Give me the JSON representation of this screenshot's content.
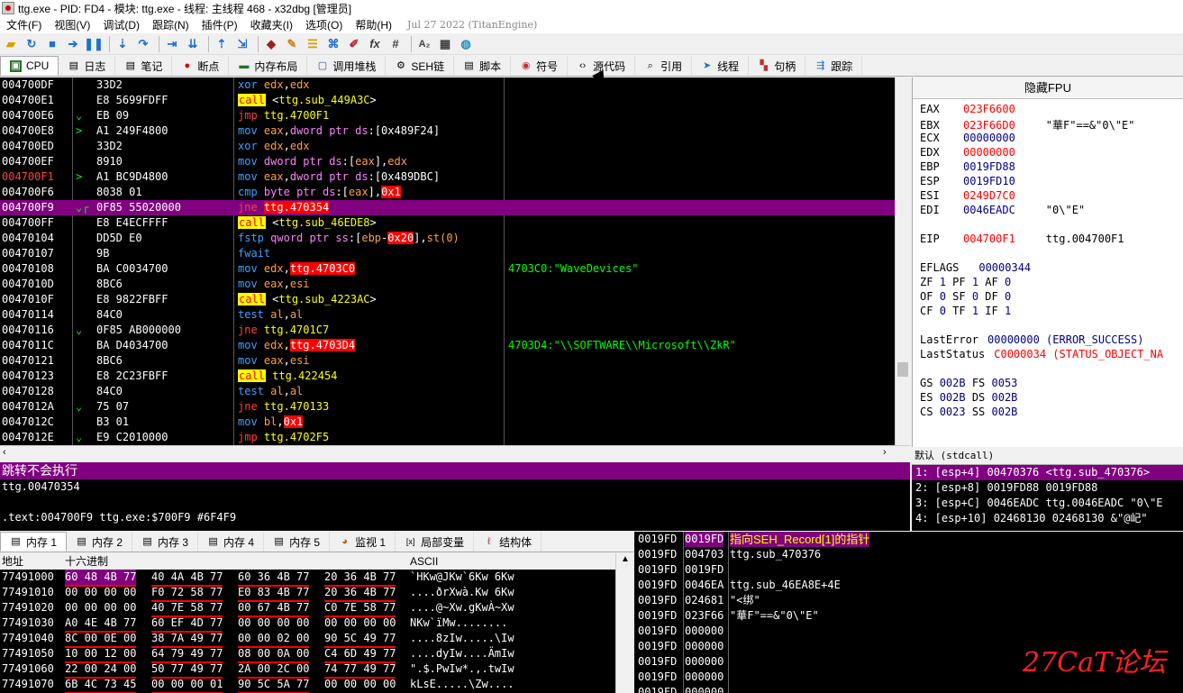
{
  "window": {
    "title": "ttg.exe - PID: FD4 - 模块: ttg.exe - 线程: 主线程 468 - x32dbg [管理员]"
  },
  "menu": {
    "items": [
      "文件(F)",
      "视图(V)",
      "调试(D)",
      "跟踪(N)",
      "插件(P)",
      "收藏夹(I)",
      "选项(O)",
      "帮助(H)"
    ],
    "date": "Jul 27 2022 (TitanEngine)"
  },
  "toolbar": {
    "fx_label": "fx",
    "hash_label": "#"
  },
  "tabs": [
    {
      "label": "CPU",
      "icon": "cpu-icon"
    },
    {
      "label": "日志",
      "icon": "log-icon"
    },
    {
      "label": "笔记",
      "icon": "notes-icon"
    },
    {
      "label": "断点",
      "icon": "breakpoint-icon"
    },
    {
      "label": "内存布局",
      "icon": "memory-map-icon"
    },
    {
      "label": "调用堆栈",
      "icon": "callstack-icon"
    },
    {
      "label": "SEH链",
      "icon": "seh-icon"
    },
    {
      "label": "脚本",
      "icon": "script-icon"
    },
    {
      "label": "符号",
      "icon": "symbols-icon"
    },
    {
      "label": "源代码",
      "icon": "source-icon"
    },
    {
      "label": "引用",
      "icon": "references-icon"
    },
    {
      "label": "线程",
      "icon": "threads-icon"
    },
    {
      "label": "句柄",
      "icon": "handles-icon"
    },
    {
      "label": "跟踪",
      "icon": "trace-icon"
    }
  ],
  "disasm": {
    "rows": [
      {
        "addr": "004700DF",
        "arrow": "",
        "bytes": "33D2",
        "ins": "xor edx,edx",
        "cmt": ""
      },
      {
        "addr": "004700E1",
        "arrow": "",
        "bytes": "E8 5699FDFF",
        "ins": "call <ttg.sub_449A3C>",
        "cmt": ""
      },
      {
        "addr": "004700E6",
        "arrow": "⌄",
        "bytes": "EB 09",
        "ins": "jmp ttg.4700F1",
        "cmt": ""
      },
      {
        "addr": "004700E8",
        "arrow": ">",
        "bytes": "A1 249F4800",
        "ins": "mov eax,dword ptr ds:[0x489F24]",
        "cmt": ""
      },
      {
        "addr": "004700ED",
        "arrow": "",
        "bytes": "33D2",
        "ins": "xor edx,edx",
        "cmt": ""
      },
      {
        "addr": "004700EF",
        "arrow": "",
        "bytes": "8910",
        "ins": "mov dword ptr ds:[eax],edx",
        "cmt": ""
      },
      {
        "addr": "004700F1",
        "arrow": ">",
        "bytes": "A1 BC9D4800",
        "ins": "mov eax,dword ptr ds:[0x489DBC]",
        "cmt": ""
      },
      {
        "addr": "004700F6",
        "arrow": "",
        "bytes": "8038 01",
        "ins": "cmp byte ptr ds:[eax],0x1",
        "cmt": ""
      },
      {
        "addr": "004700F9",
        "arrow": "⌄┌",
        "bytes": "0F85 55020000",
        "ins": "jne ttg.470354",
        "cmt": ""
      },
      {
        "addr": "004700FF",
        "arrow": "",
        "bytes": "E8 E4ECFFFF",
        "ins": "call <ttg.sub_46EDE8>",
        "cmt": ""
      },
      {
        "addr": "00470104",
        "arrow": "",
        "bytes": "DD5D E0",
        "ins": "fstp qword ptr ss:[ebp-0x20],st(0)",
        "cmt": ""
      },
      {
        "addr": "00470107",
        "arrow": "",
        "bytes": "9B",
        "ins": "fwait",
        "cmt": ""
      },
      {
        "addr": "00470108",
        "arrow": "",
        "bytes": "BA C0034700",
        "ins": "mov edx,ttg.4703C0",
        "cmt": "4703C0:\"WaveDevices\""
      },
      {
        "addr": "0047010D",
        "arrow": "",
        "bytes": "8BC6",
        "ins": "mov eax,esi",
        "cmt": ""
      },
      {
        "addr": "0047010F",
        "arrow": "",
        "bytes": "E8 9822FBFF",
        "ins": "call <ttg.sub_4223AC>",
        "cmt": ""
      },
      {
        "addr": "00470114",
        "arrow": "",
        "bytes": "84C0",
        "ins": "test al,al",
        "cmt": ""
      },
      {
        "addr": "00470116",
        "arrow": "⌄",
        "bytes": "0F85 AB000000",
        "ins": "jne ttg.4701C7",
        "cmt": ""
      },
      {
        "addr": "0047011C",
        "arrow": "",
        "bytes": "BA D4034700",
        "ins": "mov edx,ttg.4703D4",
        "cmt": "4703D4:\"\\\\SOFTWARE\\\\Microsoft\\\\ZkR\""
      },
      {
        "addr": "00470121",
        "arrow": "",
        "bytes": "8BC6",
        "ins": "mov eax,esi",
        "cmt": ""
      },
      {
        "addr": "00470123",
        "arrow": "",
        "bytes": "E8 2C23FBFF",
        "ins": "call ttg.422454",
        "cmt": ""
      },
      {
        "addr": "00470128",
        "arrow": "",
        "bytes": "84C0",
        "ins": "test al,al",
        "cmt": ""
      },
      {
        "addr": "0047012A",
        "arrow": "⌄",
        "bytes": "75 07",
        "ins": "jne ttg.470133",
        "cmt": ""
      },
      {
        "addr": "0047012C",
        "arrow": "",
        "bytes": "B3 01",
        "ins": "mov bl,0x1",
        "cmt": ""
      },
      {
        "addr": "0047012E",
        "arrow": "⌄",
        "bytes": "E9 C2010000",
        "ins": "jmp ttg.4702F5",
        "cmt": ""
      }
    ]
  },
  "registers": {
    "header": "隐藏FPU",
    "gpr": [
      {
        "name": "EAX",
        "value": "023F6600",
        "cmt": ""
      },
      {
        "name": "EBX",
        "value": "023F66D0",
        "cmt": "\"華F\"==&\"0\\\"E\""
      },
      {
        "name": "ECX",
        "value": "00000000",
        "cmt": ""
      },
      {
        "name": "EDX",
        "value": "00000000",
        "cmt": ""
      },
      {
        "name": "EBP",
        "value": "0019FD88",
        "cmt": ""
      },
      {
        "name": "ESP",
        "value": "0019FD10",
        "cmt": ""
      },
      {
        "name": "ESI",
        "value": "0249D7C0",
        "cmt": ""
      },
      {
        "name": "EDI",
        "value": "0046EADC",
        "cmt": "\"0\\\"E\""
      }
    ],
    "eip": {
      "name": "EIP",
      "value": "004700F1",
      "cmt": "ttg.004700F1"
    },
    "eflags": {
      "name": "EFLAGS",
      "value": "00000344"
    },
    "flags_rows": [
      "ZF 1  PF 1  AF 0",
      "OF 0  SF 0  DF 0",
      "CF 0  TF 1  IF 1"
    ],
    "last_error": {
      "name": "LastError",
      "value": "00000000 (ERROR_SUCCESS)"
    },
    "last_status": {
      "name": "LastStatus",
      "value": "C0000034 (STATUS_OBJECT_NA"
    },
    "seg_rows": [
      "GS 002B  FS 0053",
      "ES 002B  DS 002B",
      "CS 0023  SS 002B"
    ]
  },
  "info": {
    "header": "跳转不会执行",
    "line1": "ttg.00470354",
    "line2": "",
    "line3": ".text:004700F9 ttg.exe:$700F9 #6F4F9"
  },
  "args": {
    "conv": "默认 (stdcall)",
    "rows": [
      "1: [esp+4] 00470376 <ttg.sub_470376>",
      "2: [esp+8] 0019FD88 0019FD88",
      "3: [esp+C] 0046EADC ttg.0046EADC \"0\\\"E",
      "4: [esp+10] 02468130 02468130 &\"@屺\""
    ]
  },
  "dumptabs": [
    {
      "label": "内存 1",
      "icon": "dump-icon"
    },
    {
      "label": "内存 2",
      "icon": "dump-icon"
    },
    {
      "label": "内存 3",
      "icon": "dump-icon"
    },
    {
      "label": "内存 4",
      "icon": "dump-icon"
    },
    {
      "label": "内存 5",
      "icon": "dump-icon"
    },
    {
      "label": "监视 1",
      "icon": "watch-icon"
    },
    {
      "label": "局部变量",
      "icon": "locals-icon"
    },
    {
      "label": "结构体",
      "icon": "struct-icon"
    }
  ],
  "dump": {
    "col_addr": "地址",
    "col_hex": "十六进制",
    "col_ascii": "ASCII",
    "rows": [
      {
        "addr": "77491000",
        "g": [
          "60 48 4B 77",
          "40 4A 4B 77",
          "60 36 4B 77",
          "20 36 4B 77"
        ],
        "ascii": "`HKw@JKw`6Kw 6Kw"
      },
      {
        "addr": "77491010",
        "g": [
          "00 00 00 00",
          "F0 72 58 77",
          "E0 83 4B 77",
          "20 36 4B 77"
        ],
        "ascii": "....ðrXwà.Kw 6Kw"
      },
      {
        "addr": "77491020",
        "g": [
          "00 00 00 00",
          "40 7E 58 77",
          "00 67 4B 77",
          "C0 7E 58 77"
        ],
        "ascii": "....@~Xw.gKwÀ~Xw"
      },
      {
        "addr": "77491030",
        "g": [
          "A0 4E 4B 77",
          "60 EF 4D 77",
          "00 00 00 00",
          "00 00 00 00"
        ],
        "ascii": " NKw`ïMw........"
      },
      {
        "addr": "77491040",
        "g": [
          "8C 00 0E 00",
          "38 7A 49 77",
          "00 00 02 00",
          "90 5C 49 77"
        ],
        "ascii": "....8zIw.....\\Iw"
      },
      {
        "addr": "77491050",
        "g": [
          "10 00 12 00",
          "64 79 49 77",
          "08 00 0A 00",
          "C4 6D 49 77"
        ],
        "ascii": "....dyIw....ÄmIw"
      },
      {
        "addr": "77491060",
        "g": [
          "22 00 24 00",
          "50 77 49 77",
          "2A 00 2C 00",
          "74 77 49 77"
        ],
        "ascii": "\".$.PwIw*.,.twIw"
      },
      {
        "addr": "77491070",
        "g": [
          "6B 4C 73 45",
          "00 00 00 01",
          "90 5C 5A 77",
          "00 00 00 00"
        ],
        "ascii": "kLsE.....\\Zw...."
      }
    ]
  },
  "stack": {
    "rows": [
      {
        "addr": "0019FD",
        "val": "0019FD",
        "cmt": "指向SEH_Record[1]的指针"
      },
      {
        "addr": "0019FD",
        "val": "004703",
        "cmt": "ttg.sub_470376"
      },
      {
        "addr": "0019FD",
        "val": "0019FD",
        "cmt": ""
      },
      {
        "addr": "0019FD",
        "val": "0046EA",
        "cmt": "ttg.sub_46EA8E+4E"
      },
      {
        "addr": "0019FD",
        "val": "024681",
        "cmt": "\"<绑\""
      },
      {
        "addr": "0019FD",
        "val": "023F66",
        "cmt": "\"華F\"==&\"0\\\"E\""
      },
      {
        "addr": "0019FD",
        "val": "000000",
        "cmt": ""
      },
      {
        "addr": "0019FD",
        "val": "000000",
        "cmt": ""
      },
      {
        "addr": "0019FD",
        "val": "000000",
        "cmt": ""
      },
      {
        "addr": "0019FD",
        "val": "000000",
        "cmt": ""
      },
      {
        "addr": "0019FD",
        "val": "000000",
        "cmt": ""
      }
    ]
  },
  "watermark": "27CaT论坛"
}
